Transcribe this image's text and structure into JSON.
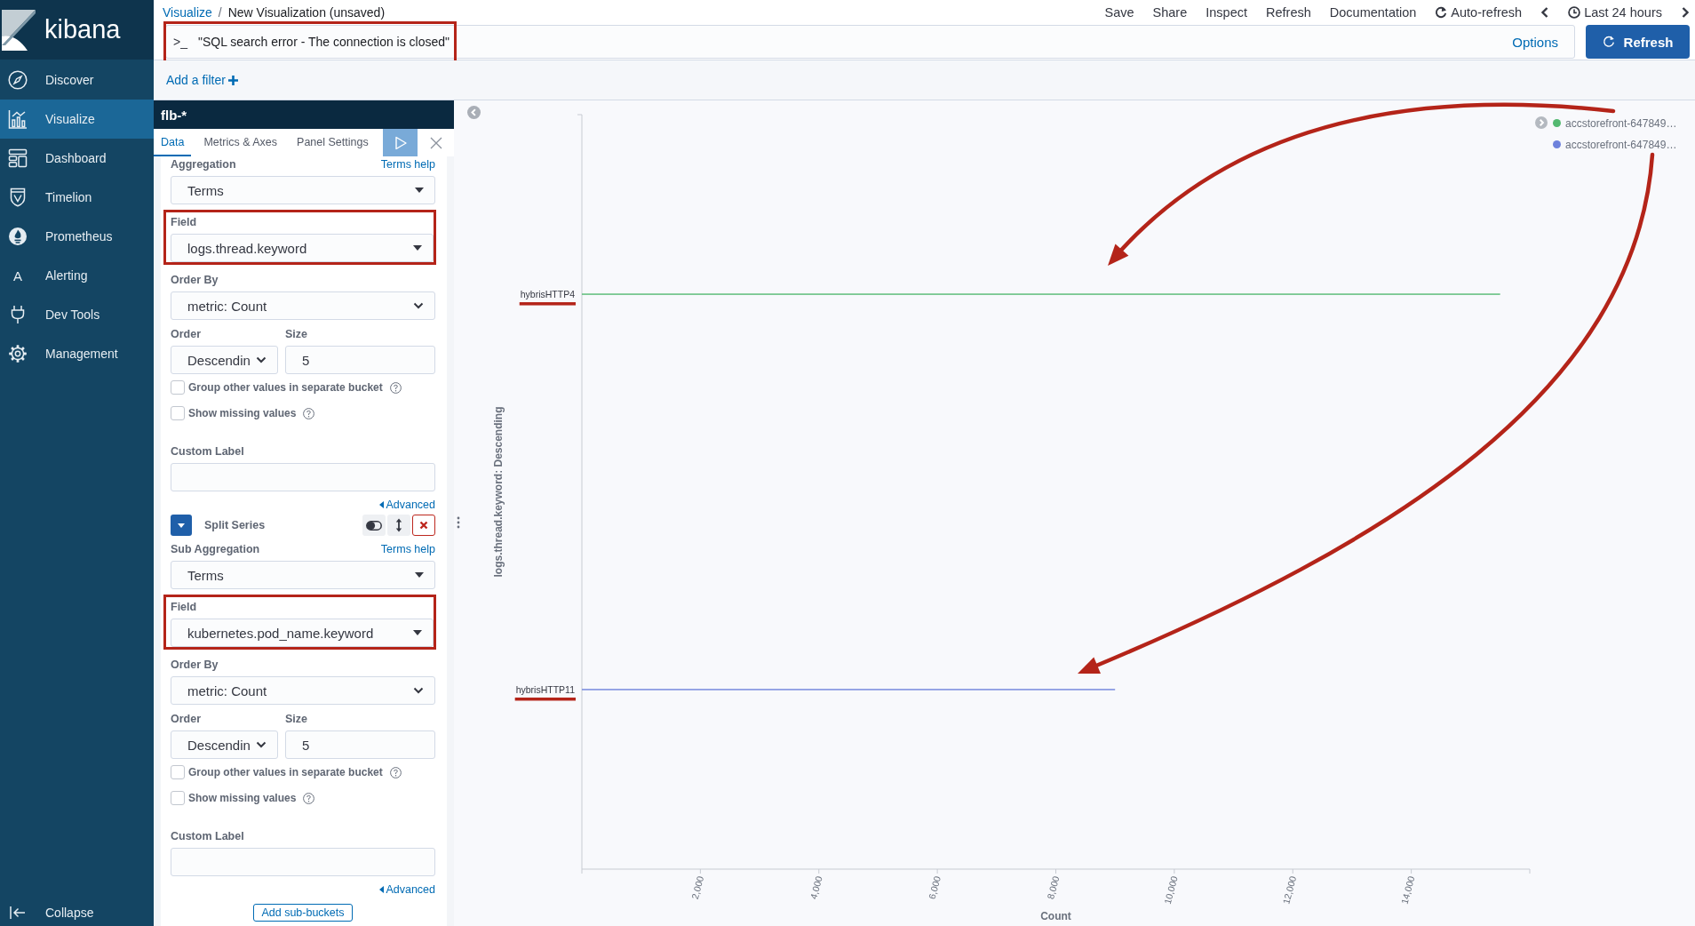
{
  "sidebar": {
    "logo": "kibana",
    "items": [
      {
        "label": "Discover",
        "selected": false
      },
      {
        "label": "Visualize",
        "selected": true
      },
      {
        "label": "Dashboard",
        "selected": false
      },
      {
        "label": "Timelion",
        "selected": false
      },
      {
        "label": "Prometheus",
        "selected": false
      },
      {
        "label": "Alerting",
        "selected": false,
        "glyph": "A"
      },
      {
        "label": "Dev Tools",
        "selected": false
      },
      {
        "label": "Management",
        "selected": false
      }
    ],
    "collapse": "Collapse"
  },
  "breadcrumbs": {
    "parent": "Visualize",
    "separator": "/",
    "current": "New Visualization (unsaved)"
  },
  "top_menu": {
    "items": [
      "Save",
      "Share",
      "Inspect",
      "Refresh",
      "Documentation"
    ],
    "auto_refresh": "Auto-refresh",
    "time_range": "Last 24 hours"
  },
  "query_bar": {
    "prompt": ">_",
    "value": "\"SQL search error - The connection is closed\"",
    "highlighted": true,
    "options": "Options",
    "button": "Refresh"
  },
  "filter_bar": {
    "add_filter": "Add a filter"
  },
  "editor": {
    "title": "flb-*",
    "tabs": [
      {
        "label": "Data",
        "selected": true
      },
      {
        "label": "Metrics & Axes",
        "selected": false
      },
      {
        "label": "Panel Settings",
        "selected": false
      }
    ],
    "sections": [
      {
        "aggregation": {
          "label": "Aggregation",
          "help": "Terms help",
          "value": "Terms"
        },
        "field": {
          "label": "Field",
          "value": "logs.thread.keyword",
          "highlighted": true
        },
        "order_by": {
          "label": "Order By",
          "value": "metric: Count"
        },
        "order": {
          "label": "Order",
          "value": "Descendin"
        },
        "size": {
          "label": "Size",
          "value": "5"
        },
        "options": [
          {
            "label": "Group other values in separate bucket",
            "checked": false
          },
          {
            "label": "Show missing values",
            "checked": false
          }
        ],
        "custom_label": {
          "label": "Custom Label"
        },
        "advanced": "Advanced"
      },
      {
        "header": {
          "title": "Split Series",
          "expanded": true
        },
        "aggregation": {
          "label": "Sub Aggregation",
          "help": "Terms help",
          "value": "Terms"
        },
        "field": {
          "label": "Field",
          "value": "kubernetes.pod_name.keyword",
          "highlighted": true
        },
        "order_by": {
          "label": "Order By",
          "value": "metric: Count"
        },
        "order": {
          "label": "Order",
          "value": "Descendin"
        },
        "size": {
          "label": "Size",
          "value": "5"
        },
        "options": [
          {
            "label": "Group other values in separate bucket",
            "checked": false
          },
          {
            "label": "Show missing values",
            "checked": false
          }
        ],
        "custom_label": {
          "label": "Custom Label"
        },
        "advanced": "Advanced"
      }
    ],
    "add_button": "Add sub-buckets"
  },
  "chart": {
    "chart_data": {
      "type": "bar",
      "orientation": "horizontal",
      "categories": [
        "hybrisHTTP4",
        "hybrisHTTP11"
      ],
      "series": [
        {
          "name": "accstorefront-647849…",
          "color": "#54b971",
          "values": [
            15500,
            null
          ]
        },
        {
          "name": "accstorefront-647849…",
          "color": "#6e82dc",
          "values": [
            null,
            9000
          ]
        }
      ],
      "xlabel": "Count",
      "ylabel": "logs.thread.keyword: Descending",
      "xlim": [
        0,
        16000
      ],
      "xticks": [
        {
          "value": 2000,
          "label": "2,000"
        },
        {
          "value": 4000,
          "label": "4,000"
        },
        {
          "value": 6000,
          "label": "6,000"
        },
        {
          "value": 8000,
          "label": "8,000"
        },
        {
          "value": 10000,
          "label": "10,000"
        },
        {
          "value": 12000,
          "label": "12,000"
        },
        {
          "value": 14000,
          "label": "14,000"
        }
      ]
    }
  }
}
